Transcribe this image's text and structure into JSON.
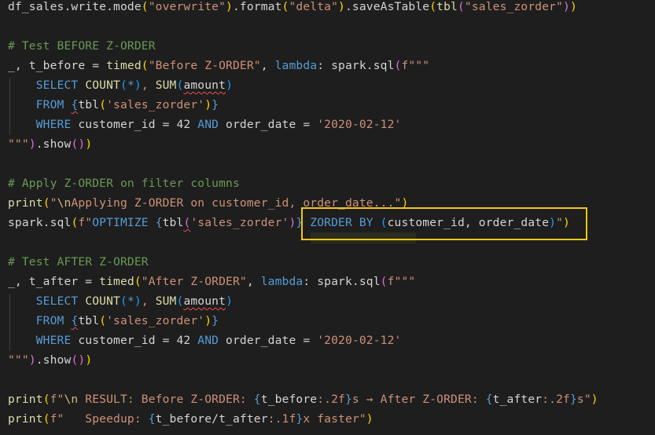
{
  "editor": {
    "lines": [
      [
        [
          "df_sales.write.mode",
          "t-plain"
        ],
        [
          "(",
          "t-paren"
        ],
        [
          "\"overwrite\"",
          "t-str"
        ],
        [
          ")",
          "t-paren"
        ],
        [
          ".format",
          "t-plain"
        ],
        [
          "(",
          "t-paren"
        ],
        [
          "\"delta\"",
          "t-str"
        ],
        [
          ")",
          "t-paren"
        ],
        [
          ".saveAsTable",
          "t-plain"
        ],
        [
          "(",
          "t-paren"
        ],
        [
          "tbl",
          "t-fn"
        ],
        [
          "(",
          "t-paren2"
        ],
        [
          "\"sales_zorder\"",
          "t-str"
        ],
        [
          ")",
          "t-paren2"
        ],
        [
          ")",
          "t-paren"
        ]
      ],
      [],
      [
        [
          "# Test BEFORE Z-ORDER",
          "t-comment"
        ]
      ],
      [
        [
          "_, t_before = ",
          "t-plain"
        ],
        [
          "timed",
          "t-fn"
        ],
        [
          "(",
          "t-paren"
        ],
        [
          "\"Before Z-ORDER\"",
          "t-str"
        ],
        [
          ", ",
          "t-plain"
        ],
        [
          "lambda",
          "t-kw"
        ],
        [
          ": spark.sql",
          "t-plain"
        ],
        [
          "(",
          "t-paren2"
        ],
        [
          "f\"\"\"",
          "t-str"
        ]
      ],
      [
        [
          "    ",
          "t-plain"
        ],
        [
          "SELECT ",
          "t-sql"
        ],
        [
          "COUNT",
          "t-fn"
        ],
        [
          "(",
          "t-paren3"
        ],
        [
          "*",
          "t-sql"
        ],
        [
          ")",
          "t-paren3"
        ],
        [
          ", ",
          "t-str"
        ],
        [
          "SUM",
          "t-fn"
        ],
        [
          "(",
          "t-paren3"
        ],
        [
          "amount",
          "t-plain squiggle"
        ],
        [
          ")",
          "t-paren3"
        ]
      ],
      [
        [
          "    ",
          "t-plain"
        ],
        [
          "FROM ",
          "t-sql"
        ],
        [
          "{",
          "t-brace squiggle"
        ],
        [
          "tbl",
          "t-plain"
        ],
        [
          "(",
          "t-paren"
        ],
        [
          "'sales_zorder'",
          "t-str"
        ],
        [
          ")",
          "t-paren"
        ],
        [
          "}",
          "t-brace"
        ]
      ],
      [
        [
          "    ",
          "t-plain"
        ],
        [
          "WHERE ",
          "t-sql"
        ],
        [
          "customer_id = 42 ",
          "t-plain"
        ],
        [
          "AND ",
          "t-sql"
        ],
        [
          "order_date = ",
          "t-plain"
        ],
        [
          "'2020-02-12'",
          "t-str"
        ]
      ],
      [
        [
          "\"\"\"",
          "t-str"
        ],
        [
          ")",
          "t-paren2"
        ],
        [
          ".show",
          "t-plain"
        ],
        [
          "()",
          "t-paren2"
        ],
        [
          ")",
          "t-paren"
        ]
      ],
      [],
      [
        [
          "# Apply Z-ORDER on filter columns",
          "t-comment"
        ]
      ],
      [
        [
          "print",
          "t-fn"
        ],
        [
          "(",
          "t-paren"
        ],
        [
          "\"",
          "t-str"
        ],
        [
          "\\n",
          "t-esc"
        ],
        [
          "Applying Z-ORDER on customer_id, order_date...\"",
          "t-str"
        ],
        [
          ")",
          "t-paren"
        ]
      ],
      [
        [
          "spark.sql",
          "t-plain"
        ],
        [
          "(",
          "t-paren"
        ],
        [
          "f\"",
          "t-str"
        ],
        [
          "OPTIMIZE ",
          "t-sql"
        ],
        [
          "{",
          "t-brace"
        ],
        [
          "tbl",
          "t-plain"
        ],
        [
          "(",
          "t-paren2 squiggle"
        ],
        [
          "'sales_zorder'",
          "t-str"
        ],
        [
          ")",
          "t-paren2"
        ],
        [
          "}",
          "t-brace"
        ],
        [
          " ",
          "t-str"
        ],
        [
          "ZORDER BY ",
          "t-sql"
        ],
        [
          "(",
          "t-paren3"
        ],
        [
          "customer_id, order_date",
          "t-plain"
        ],
        [
          ")",
          "t-paren3"
        ],
        [
          "\"",
          "t-str"
        ],
        [
          ")",
          "t-paren"
        ]
      ],
      [],
      [
        [
          "# Test AFTER Z-ORDER",
          "t-comment"
        ]
      ],
      [
        [
          "_, t_after = ",
          "t-plain"
        ],
        [
          "timed",
          "t-fn"
        ],
        [
          "(",
          "t-paren"
        ],
        [
          "\"After Z-ORDER\"",
          "t-str"
        ],
        [
          ", ",
          "t-plain"
        ],
        [
          "lambda",
          "t-kw"
        ],
        [
          ": spark.sql",
          "t-plain"
        ],
        [
          "(",
          "t-paren2"
        ],
        [
          "f\"\"\"",
          "t-str"
        ]
      ],
      [
        [
          "    ",
          "t-plain"
        ],
        [
          "SELECT ",
          "t-sql"
        ],
        [
          "COUNT",
          "t-fn"
        ],
        [
          "(",
          "t-paren3"
        ],
        [
          "*",
          "t-sql"
        ],
        [
          ")",
          "t-paren3"
        ],
        [
          ", ",
          "t-str"
        ],
        [
          "SUM",
          "t-fn"
        ],
        [
          "(",
          "t-paren3"
        ],
        [
          "amount",
          "t-plain squiggle"
        ],
        [
          ")",
          "t-paren3"
        ]
      ],
      [
        [
          "    ",
          "t-plain"
        ],
        [
          "FROM ",
          "t-sql"
        ],
        [
          "{",
          "t-brace squiggle"
        ],
        [
          "tbl",
          "t-plain"
        ],
        [
          "(",
          "t-paren"
        ],
        [
          "'sales_zorder'",
          "t-str"
        ],
        [
          ")",
          "t-paren"
        ],
        [
          "}",
          "t-brace"
        ]
      ],
      [
        [
          "    ",
          "t-plain"
        ],
        [
          "WHERE ",
          "t-sql"
        ],
        [
          "customer_id = 42 ",
          "t-plain"
        ],
        [
          "AND ",
          "t-sql"
        ],
        [
          "order_date = ",
          "t-plain"
        ],
        [
          "'2020-02-12'",
          "t-str"
        ]
      ],
      [
        [
          "\"\"\"",
          "t-str"
        ],
        [
          ")",
          "t-paren2"
        ],
        [
          ".show",
          "t-plain"
        ],
        [
          "()",
          "t-paren2"
        ],
        [
          ")",
          "t-paren"
        ]
      ],
      [],
      [
        [
          "print",
          "t-fn"
        ],
        [
          "(",
          "t-paren"
        ],
        [
          "f\"",
          "t-str"
        ],
        [
          "\\n",
          "t-esc"
        ],
        [
          " RESULT: Before Z-ORDER: ",
          "t-str"
        ],
        [
          "{",
          "t-brace"
        ],
        [
          "t_before",
          "t-plain"
        ],
        [
          ":.2f",
          "t-str"
        ],
        [
          "}",
          "t-brace"
        ],
        [
          "s → After Z-ORDER: ",
          "t-str"
        ],
        [
          "{",
          "t-brace"
        ],
        [
          "t_after",
          "t-plain"
        ],
        [
          ":.2f",
          "t-str"
        ],
        [
          "}",
          "t-brace"
        ],
        [
          "s\"",
          "t-str"
        ],
        [
          ")",
          "t-paren"
        ]
      ],
      [
        [
          "print",
          "t-fn"
        ],
        [
          "(",
          "t-paren"
        ],
        [
          "f\"   Speedup: ",
          "t-str"
        ],
        [
          "{",
          "t-brace"
        ],
        [
          "t_before/t_after",
          "t-plain"
        ],
        [
          ":.1f",
          "t-str"
        ],
        [
          "}",
          "t-brace"
        ],
        [
          "x faster\"",
          "t-str"
        ],
        [
          ")",
          "t-paren"
        ]
      ]
    ]
  }
}
